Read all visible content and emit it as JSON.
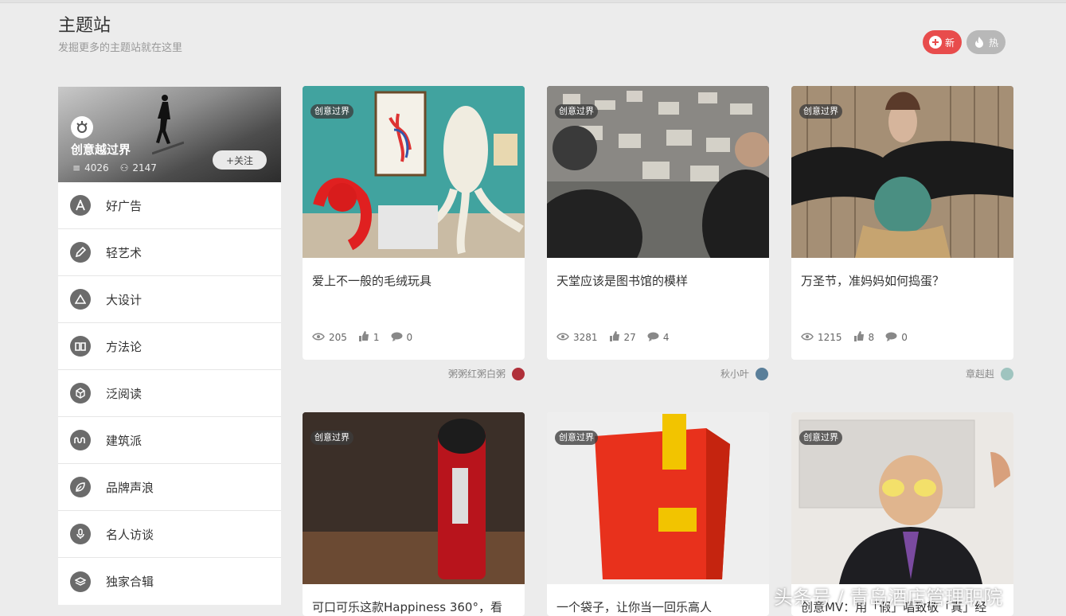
{
  "header": {
    "title": "主题站",
    "subtitle": "发掘更多的主题站就在这里",
    "sort_new": "新",
    "sort_hot": "热"
  },
  "sidebar": {
    "station_name": "创意越过界",
    "article_count": "4026",
    "follower_count": "2147",
    "follow_label": "+关注",
    "items": [
      {
        "label": "好广告",
        "icon": "letter-a-icon"
      },
      {
        "label": "轻艺术",
        "icon": "pencil-icon"
      },
      {
        "label": "大设计",
        "icon": "triangle-icon"
      },
      {
        "label": "方法论",
        "icon": "book-icon"
      },
      {
        "label": "泛阅读",
        "icon": "cube-icon"
      },
      {
        "label": "建筑派",
        "icon": "wave-icon"
      },
      {
        "label": "品牌声浪",
        "icon": "leaf-icon"
      },
      {
        "label": "名人访谈",
        "icon": "microphone-icon"
      },
      {
        "label": "独家合辑",
        "icon": "layers-icon"
      }
    ]
  },
  "cards": [
    {
      "tag": "创意过界",
      "title": "爱上不一般的毛绒玩具",
      "views": "205",
      "likes": "1",
      "comments": "0",
      "author": "粥粥红粥白粥"
    },
    {
      "tag": "创意过界",
      "title": "天堂应该是图书馆的模样",
      "views": "3281",
      "likes": "27",
      "comments": "4",
      "author": "秋小叶"
    },
    {
      "tag": "创意过界",
      "title": "万圣节，准妈妈如何捣蛋？",
      "views": "1215",
      "likes": "8",
      "comments": "0",
      "author": "章赳赳"
    },
    {
      "tag": "创意过界",
      "title": "可口可乐这款Happiness 360°，看"
    },
    {
      "tag": "创意过界",
      "title": "一个袋子，让你当一回乐高人"
    },
    {
      "tag": "创意过界",
      "title": "创意MV：用「假」唱致敬「真」经"
    }
  ],
  "watermark": "头条号 / 青岛酒店管理职院",
  "colors": {
    "accent_new": "#e84c4c",
    "hot_gray": "#b8b8b8",
    "icon_gray": "#6b6b6b"
  }
}
